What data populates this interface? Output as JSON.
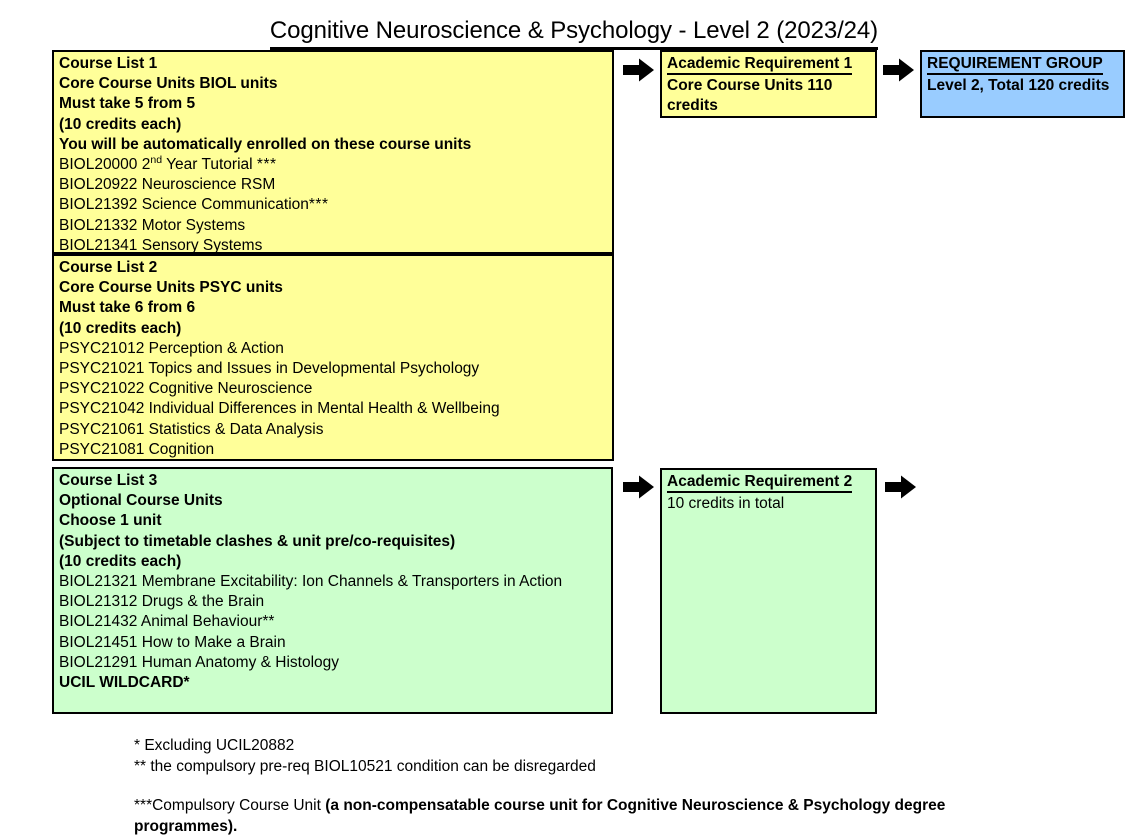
{
  "page": {
    "title": "Cognitive Neuroscience & Psychology - Level 2 (2023/24)"
  },
  "course_list_1": {
    "heading": "Course List 1",
    "subheading": "Core Course Units BIOL units",
    "rule": "Must take 5 from 5",
    "credits_note": "(10 credits each)",
    "enrolment_note": "You will be automatically enrolled on these course units",
    "units": [
      {
        "code": "BIOL20000",
        "title": "Year Tutorial",
        "prefix": "2",
        "superscript": "nd",
        "marker": "***"
      },
      {
        "code": "BIOL20922",
        "title": "Neuroscience RSM",
        "marker": ""
      },
      {
        "code": "BIOL21392",
        "title": "Science Communication",
        "marker": "***"
      },
      {
        "code": "BIOL21332",
        "title": "Motor Systems",
        "marker": ""
      },
      {
        "code": "BIOL21341",
        "title": "Sensory Systems",
        "marker": ""
      }
    ]
  },
  "course_list_2": {
    "heading": "Course List 2",
    "subheading": "Core Course Units PSYC units",
    "rule": "Must take 6 from 6",
    "credits_note": "(10 credits each)",
    "units": [
      "PSYC21012 Perception & Action",
      "PSYC21021 Topics and Issues in Developmental Psychology",
      "PSYC21022 Cognitive Neuroscience",
      "PSYC21042 Individual Differences in Mental Health & Wellbeing",
      "PSYC21061 Statistics & Data Analysis",
      "PSYC21081 Cognition"
    ]
  },
  "course_list_3": {
    "heading": "Course List 3",
    "subheading": "Optional Course Units",
    "rule": "Choose 1 unit",
    "clash_note": "(Subject to timetable clashes & unit pre/co-requisites)",
    "credits_note": "(10 credits each)",
    "units": [
      "BIOL21321 Membrane Excitability: Ion Channels & Transporters in Action",
      "BIOL21312 Drugs & the Brain",
      "BIOL21432 Animal Behaviour**",
      "BIOL21451 How to Make a Brain",
      "BIOL21291 Human Anatomy & Histology"
    ],
    "wildcard": "UCIL WILDCARD*"
  },
  "academic_requirement_1": {
    "heading": "Academic Requirement 1",
    "detail": "Core Course Units 110 credits"
  },
  "academic_requirement_2": {
    "heading": "Academic Requirement 2",
    "detail": "10 credits in total"
  },
  "requirement_group": {
    "heading": "REQUIREMENT GROUP",
    "detail": "Level 2, Total 120 credits"
  },
  "footnotes": {
    "note_1": "* Excluding UCIL20882",
    "note_2": "** the compulsory pre-req BIOL10521 condition can be disregarded",
    "note_3_prefix": "***Compulsory Course Unit ",
    "note_3_bold": "(a non-compensatable course unit for Cognitive Neuroscience & Psychology degree programmes)."
  },
  "colors": {
    "yellow": "#ffff99",
    "green": "#ccffcc",
    "blue": "#99ccff",
    "border": "#000000"
  },
  "icons": {
    "arrow_right": "arrow-right-icon"
  }
}
